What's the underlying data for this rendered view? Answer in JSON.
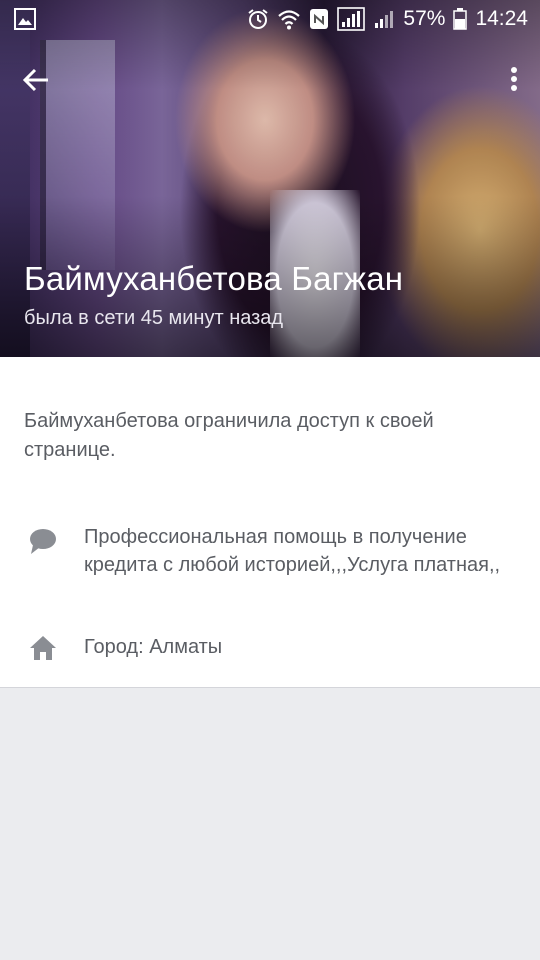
{
  "status_bar": {
    "battery_percent": "57%",
    "time": "14:24",
    "icons": [
      "gallery-icon",
      "alarm-icon",
      "wifi-icon",
      "nfc-icon",
      "signal-sim1-icon",
      "signal-sim2-icon",
      "battery-icon"
    ]
  },
  "app_bar": {
    "back_icon": "arrow-left-icon",
    "menu_icon": "more-vertical-icon"
  },
  "profile": {
    "name": "Баймуханбетова Багжан",
    "last_seen": "была в сети 45 минут назад"
  },
  "info": {
    "restricted_notice": "Баймуханбетова ограничила доступ к своей странице.",
    "description": "Профессиональная помощь в получение кредита с любой историей,,,Услуга платная,,",
    "description_icon": "comment-icon",
    "city": "Город: Алматы",
    "city_icon": "home-icon"
  },
  "colors": {
    "card_background": "#ffffff",
    "page_background": "#ebecef",
    "secondary_text": "#5a5d63",
    "icon_gray": "#8a8d93"
  }
}
